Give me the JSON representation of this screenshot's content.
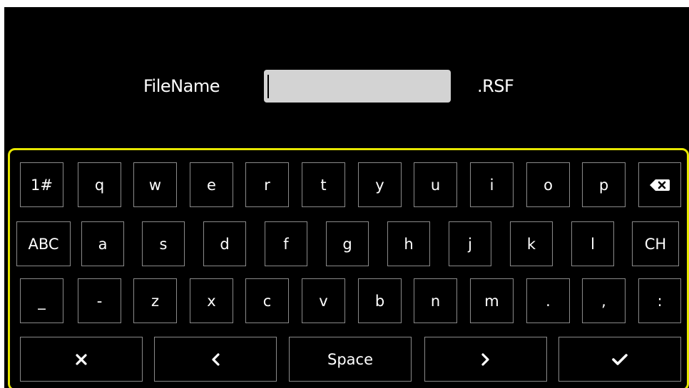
{
  "filename": {
    "label": "FileName",
    "value": "",
    "extension": ".RSF"
  },
  "keyboard": {
    "rows": [
      [
        "1#",
        "q",
        "w",
        "e",
        "r",
        "t",
        "y",
        "u",
        "i",
        "o",
        "p",
        "backspace-icon"
      ],
      [
        "ABC",
        "a",
        "s",
        "d",
        "f",
        "g",
        "h",
        "j",
        "k",
        "l",
        "CH"
      ],
      [
        "_",
        "-",
        "z",
        "x",
        "c",
        "v",
        "b",
        "n",
        "m",
        ".",
        ",",
        ":"
      ],
      [
        "close-icon",
        "chevron-left-icon",
        "Space",
        "chevron-right-icon",
        "checkmark-icon"
      ]
    ],
    "row1": {
      "k0": "1#",
      "k1": "q",
      "k2": "w",
      "k3": "e",
      "k4": "r",
      "k5": "t",
      "k6": "y",
      "k7": "u",
      "k8": "i",
      "k9": "o",
      "k10": "p"
    },
    "row2": {
      "k0": "ABC",
      "k1": "a",
      "k2": "s",
      "k3": "d",
      "k4": "f",
      "k5": "g",
      "k6": "h",
      "k7": "j",
      "k8": "k",
      "k9": "l",
      "k10": "CH"
    },
    "row3": {
      "k0": "_",
      "k1": "-",
      "k2": "z",
      "k3": "x",
      "k4": "c",
      "k5": "v",
      "k6": "b",
      "k7": "n",
      "k8": "m",
      "k9": ".",
      "k10": ",",
      "k11": ":"
    },
    "row4": {
      "space": "Space"
    }
  },
  "colors": {
    "background": "#000000",
    "keyboard_border": "#e6e600",
    "key_border": "#8a8a8a",
    "input_fill": "#d3d3d3",
    "text": "#ffffff"
  }
}
